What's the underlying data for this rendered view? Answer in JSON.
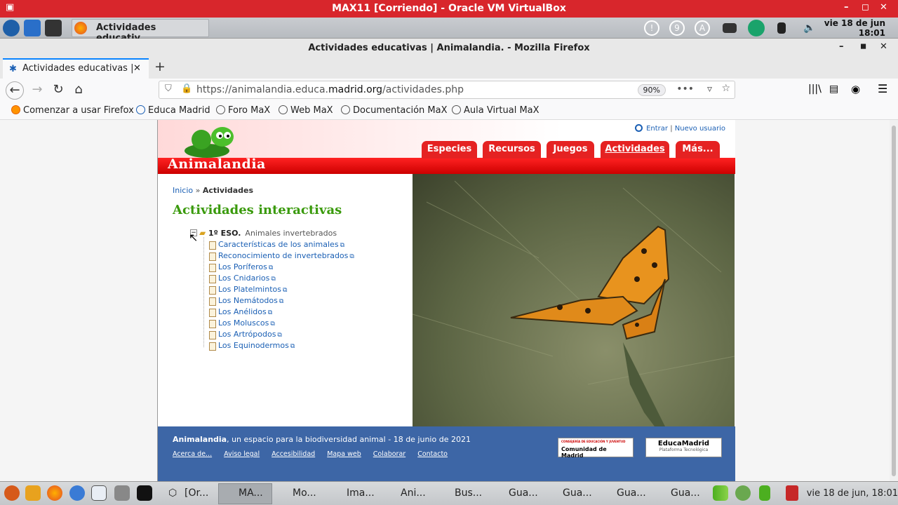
{
  "vbox": {
    "title": "MAX11 [Corriendo] - Oracle VM VirtualBox",
    "min": "–",
    "max": "◻",
    "close": "✕"
  },
  "top_panel": {
    "task_label": "Actividades educativ…",
    "clock_line1": "vie 18 de jun",
    "clock_line2": "18:01",
    "tray_labels": [
      "!",
      "9",
      "A"
    ]
  },
  "firefox": {
    "window_title": "Actividades educativas | Animalandia. - Mozilla Firefox",
    "tab_title": "Actividades educativas |",
    "tab_close": "✕",
    "new_tab": "+",
    "url_prefix": "https://animalandia.educa.",
    "url_domain": "madrid.org",
    "url_path": "/actividades.php",
    "zoom": "90%",
    "bookmarks": [
      "Comenzar a usar Firefox",
      "Educa Madrid",
      "Foro MaX",
      "Web MaX",
      "Documentación MaX",
      "Aula Virtual MaX"
    ]
  },
  "site": {
    "logo": "Animalandia",
    "login": "Entrar",
    "register": "Nuevo usuario",
    "nav": [
      "Especies",
      "Recursos",
      "Juegos",
      "Actividades",
      "Más..."
    ],
    "breadcrumb_home": "Inicio",
    "breadcrumb_sep": "»",
    "breadcrumb_current": "Actividades",
    "heading": "Actividades interactivas",
    "tree_root": "1º ESO.",
    "tree_root_sub": "Animales invertebrados",
    "activities": [
      "Características de los animales",
      "Reconocimiento de invertebrados",
      "Los Poríferos",
      "Los Cnidarios",
      "Los Platelmintos",
      "Los Nemátodos",
      "Los Anélidos",
      "Los Moluscos",
      "Los Artrópodos",
      "Los Equinodermos"
    ],
    "footer_brand": "Animalandia",
    "footer_text": ", un espacio para la biodiversidad animal - 18 de junio de 2021",
    "footer_links": [
      "Acerca de...",
      "Aviso legal",
      "Accesibilidad",
      "Mapa web",
      "Colaborar",
      "Contacto"
    ],
    "badge1_small": "CONSEJERÍA DE EDUCACIÓN Y JUVENTUD",
    "badge1": "Comunidad de Madrid",
    "badge2": "EducaMadrid",
    "badge2_sub": "Plataforma Tecnológica"
  },
  "taskbar": {
    "items": [
      "[Or...",
      "MA...",
      "Mo...",
      "Ima...",
      "Ani...",
      "Bus...",
      "Gua...",
      "Gua...",
      "Gua...",
      "Gua..."
    ],
    "clock": "vie 18 de jun, 18:01"
  },
  "colors": {
    "vbox_red": "#d8262c",
    "site_red": "#e52222",
    "heading_green": "#3a9a0c",
    "link_blue": "#1a5fb4",
    "footer_blue": "#3d66a6"
  }
}
